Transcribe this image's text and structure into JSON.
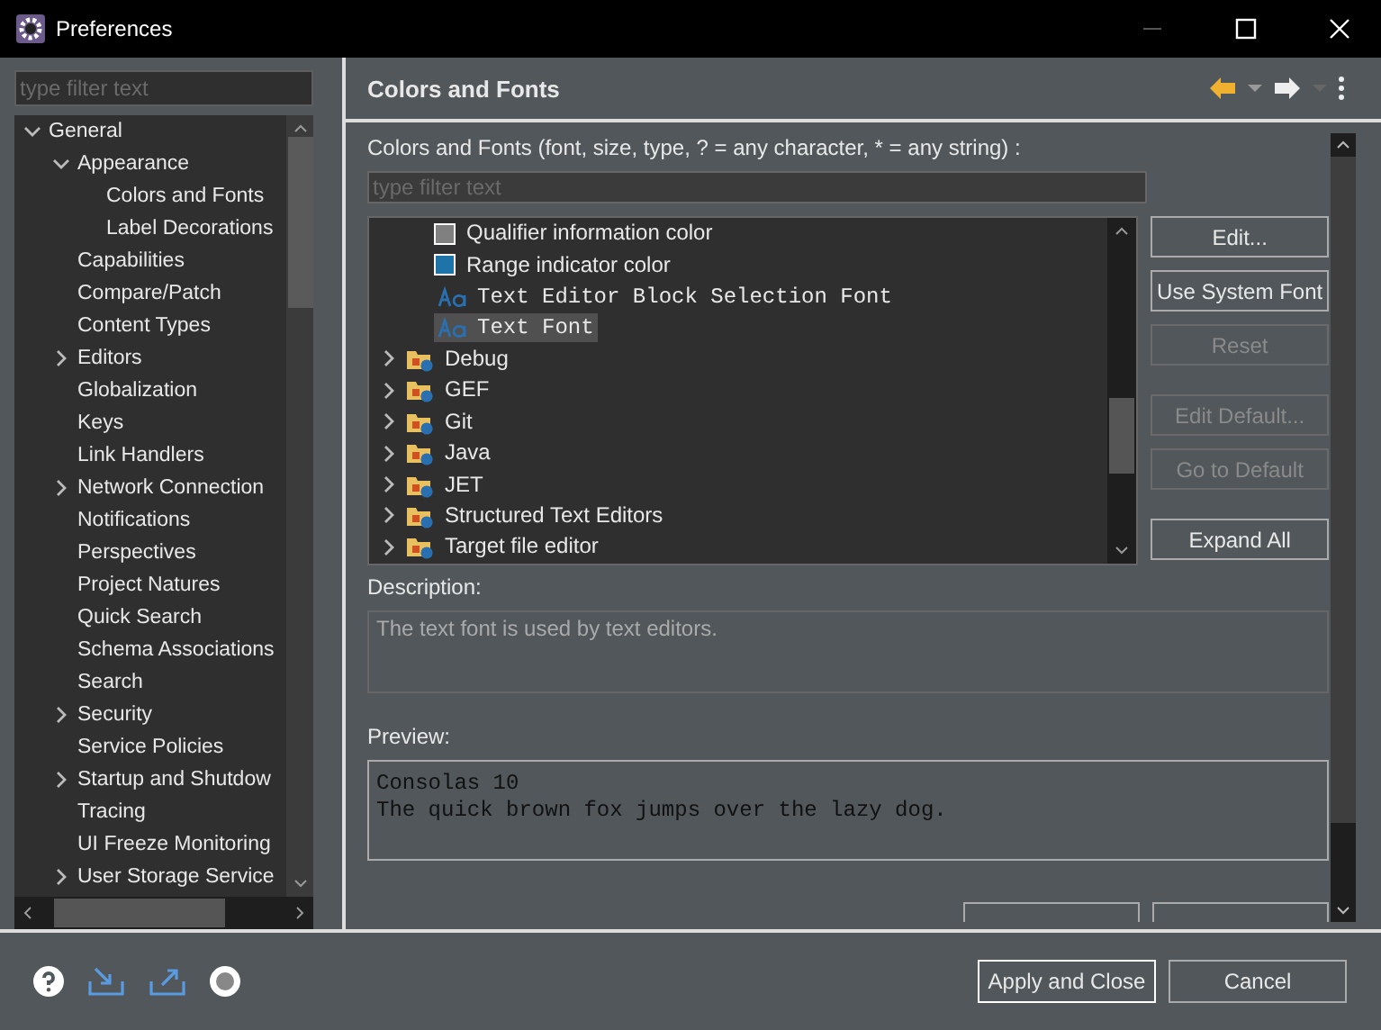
{
  "window": {
    "title": "Preferences"
  },
  "sidebar": {
    "filter": {
      "placeholder": "type filter text"
    },
    "tree": [
      {
        "label": "General",
        "expanded": true,
        "children": [
          {
            "label": "Appearance",
            "expanded": true,
            "children": [
              {
                "label": "Colors and Fonts"
              },
              {
                "label": "Label Decorations"
              }
            ]
          },
          {
            "label": "Capabilities"
          },
          {
            "label": "Compare/Patch"
          },
          {
            "label": "Content Types"
          },
          {
            "label": "Editors",
            "expanded": false
          },
          {
            "label": "Globalization"
          },
          {
            "label": "Keys"
          },
          {
            "label": "Link Handlers"
          },
          {
            "label": "Network Connection",
            "expanded": false
          },
          {
            "label": "Notifications"
          },
          {
            "label": "Perspectives"
          },
          {
            "label": "Project Natures"
          },
          {
            "label": "Quick Search"
          },
          {
            "label": "Schema Associations"
          },
          {
            "label": "Search"
          },
          {
            "label": "Security",
            "expanded": false
          },
          {
            "label": "Service Policies"
          },
          {
            "label": "Startup and Shutdow",
            "expanded": false
          },
          {
            "label": "Tracing"
          },
          {
            "label": "UI Freeze Monitoring"
          },
          {
            "label": "User Storage Service",
            "expanded": false
          }
        ]
      }
    ]
  },
  "page": {
    "title": "Colors and Fonts",
    "filter_label": "Colors and Fonts (font, size, type, ? = any character, * = any string) :",
    "filter": {
      "placeholder": "type filter text"
    },
    "items": [
      {
        "kind": "color",
        "label": "Qualifier information color",
        "color": "#808080",
        "selected": false
      },
      {
        "kind": "color",
        "label": "Range indicator color",
        "color": "#1e73a8",
        "selected": false
      },
      {
        "kind": "font",
        "label": "Text Editor Block Selection Font",
        "selected": false
      },
      {
        "kind": "font",
        "label": "Text Font",
        "selected": true
      },
      {
        "kind": "category",
        "label": "Debug",
        "expanded": false,
        "selected": false
      },
      {
        "kind": "category",
        "label": "GEF",
        "expanded": false,
        "selected": false
      },
      {
        "kind": "category",
        "label": "Git",
        "expanded": false,
        "selected": false
      },
      {
        "kind": "category",
        "label": "Java",
        "expanded": false,
        "selected": false
      },
      {
        "kind": "category",
        "label": "JET",
        "expanded": false,
        "selected": false
      },
      {
        "kind": "category",
        "label": "Structured Text Editors",
        "expanded": false,
        "selected": false
      },
      {
        "kind": "category",
        "label": "Target file editor",
        "expanded": false,
        "selected": false
      }
    ],
    "button_groups": [
      [
        {
          "label": "Edit...",
          "disabled": false
        },
        {
          "label": "Use System Font",
          "disabled": false
        },
        {
          "label": "Reset",
          "disabled": true
        }
      ],
      [
        {
          "label": "Edit Default...",
          "disabled": true
        },
        {
          "label": "Go to Default",
          "disabled": true
        }
      ],
      [
        {
          "label": "Expand All",
          "disabled": false
        }
      ]
    ],
    "description_label": "Description:",
    "description": "The text font is used by text editors.",
    "preview_label": "Preview:",
    "preview": [
      "Consolas 10",
      "The quick brown fox jumps over the lazy dog."
    ]
  },
  "footer": {
    "buttons": [
      {
        "label": "Apply and Close",
        "default": true
      },
      {
        "label": "Cancel",
        "default": false
      }
    ]
  }
}
